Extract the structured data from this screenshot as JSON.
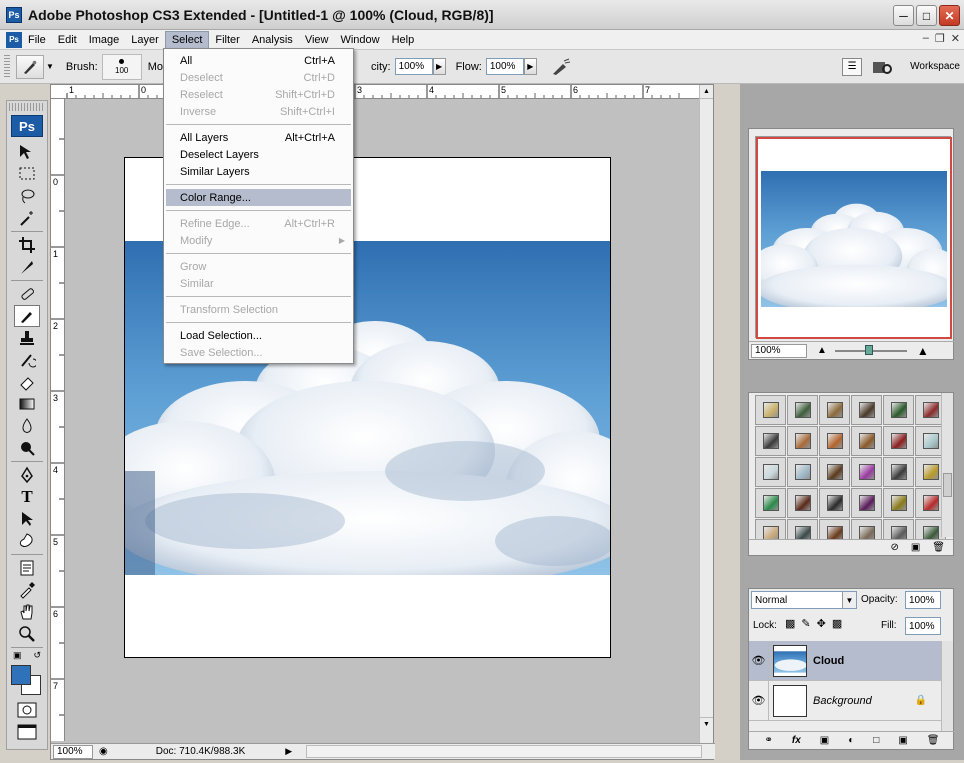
{
  "window": {
    "title": "Adobe Photoshop CS3 Extended - [Untitled-1 @ 100% (Cloud, RGB/8)]",
    "app_icon": "Ps"
  },
  "menubar": {
    "items": [
      "File",
      "Edit",
      "Image",
      "Layer",
      "Select",
      "Filter",
      "Analysis",
      "View",
      "Window",
      "Help"
    ],
    "active": "Select"
  },
  "options_bar": {
    "brush_label": "Brush:",
    "brush_size": "100",
    "mode_label_partial": "Mo",
    "opacity_label_partial": "city:",
    "opacity_value": "100%",
    "flow_label": "Flow:",
    "flow_value": "100%",
    "workspace_label": "Workspace"
  },
  "toolbox": {
    "logo": "Ps",
    "tools": [
      "move-icon",
      "marquee-icon",
      "lasso-icon",
      "magic-wand-icon",
      "crop-icon",
      "slice-icon",
      "healing-brush-icon",
      "brush-icon",
      "clone-stamp-icon",
      "history-brush-icon",
      "eraser-icon",
      "gradient-icon",
      "blur-icon",
      "dodge-icon",
      "pen-icon",
      "type-icon",
      "path-selection-icon",
      "shape-icon",
      "notes-icon",
      "eyedropper-icon",
      "hand-icon",
      "zoom-icon"
    ],
    "foreground_color": "#3072b9",
    "background_color": "#ffffff"
  },
  "select_menu": {
    "groups": [
      [
        {
          "label": "All",
          "shortcut": "Ctrl+A",
          "enabled": true
        },
        {
          "label": "Deselect",
          "shortcut": "Ctrl+D",
          "enabled": false
        },
        {
          "label": "Reselect",
          "shortcut": "Shift+Ctrl+D",
          "enabled": false
        },
        {
          "label": "Inverse",
          "shortcut": "Shift+Ctrl+I",
          "enabled": false
        }
      ],
      [
        {
          "label": "All Layers",
          "shortcut": "Alt+Ctrl+A",
          "enabled": true
        },
        {
          "label": "Deselect Layers",
          "shortcut": "",
          "enabled": true
        },
        {
          "label": "Similar Layers",
          "shortcut": "",
          "enabled": true
        }
      ],
      [
        {
          "label": "Color Range...",
          "shortcut": "",
          "enabled": true,
          "highlighted": true
        }
      ],
      [
        {
          "label": "Refine Edge...",
          "shortcut": "Alt+Ctrl+R",
          "enabled": false
        },
        {
          "label": "Modify",
          "shortcut": "",
          "enabled": false,
          "submenu": true
        }
      ],
      [
        {
          "label": "Grow",
          "shortcut": "",
          "enabled": false
        },
        {
          "label": "Similar",
          "shortcut": "",
          "enabled": false
        }
      ],
      [
        {
          "label": "Transform Selection",
          "shortcut": "",
          "enabled": false
        }
      ],
      [
        {
          "label": "Load Selection...",
          "shortcut": "",
          "enabled": true
        },
        {
          "label": "Save Selection...",
          "shortcut": "",
          "enabled": false
        }
      ]
    ]
  },
  "document": {
    "ruler_top_numbers": [
      "1",
      "0",
      "3",
      "4",
      "5",
      "6",
      "7"
    ],
    "ruler_left_numbers": [
      "0",
      "1",
      "2",
      "3",
      "4",
      "5",
      "6",
      "7"
    ],
    "zoom": "100%",
    "doc_info": "Doc: 710.4K/988.3K"
  },
  "navigator": {
    "zoom": "100%"
  },
  "styles_panel": {
    "swatches": [
      "#c9b06a",
      "#3e5e3a",
      "#8b6a3a",
      "#4a3a28",
      "#2a5a2a",
      "#8a2a2a",
      "#3a3a3a",
      "#a86a3a",
      "#b3642e",
      "#8a5a2a",
      "#8b1f1f",
      "#a8c8cc",
      "#c8d8dc",
      "#9fb8c8",
      "#5a3a1a",
      "#9a3aa0",
      "#3a3a3a",
      "#b89a2a",
      "#2a8a4a",
      "#5a2a1a",
      "#2a2a2a",
      "#5a1a5a",
      "#8a7a1a",
      "#b82a2a",
      "#c8a87a",
      "#3a4a4a",
      "#6a3a1a",
      "#7a6a5a",
      "#5a5a5a",
      "#3a5a3a"
    ]
  },
  "layers_panel": {
    "blend_mode": "Normal",
    "opacity_label": "Opacity:",
    "opacity_value": "100%",
    "lock_label": "Lock:",
    "fill_label": "Fill:",
    "fill_value": "100%",
    "layers": [
      {
        "name": "Cloud",
        "active": true,
        "locked": false
      },
      {
        "name": "Background",
        "active": false,
        "locked": true
      }
    ]
  }
}
